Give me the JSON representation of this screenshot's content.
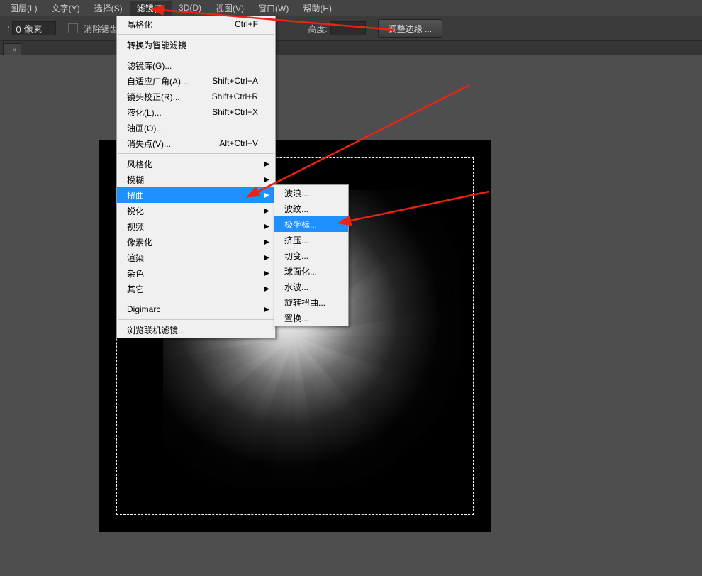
{
  "menubar": {
    "items": [
      "图层(L)",
      "文字(Y)",
      "选择(S)",
      "滤镜(T)",
      "3D(D)",
      "视图(V)",
      "窗口(W)",
      "帮助(H)"
    ],
    "open_index": 3
  },
  "options_bar": {
    "px_value": "0 像素",
    "antialias_label": "消除锯齿",
    "height_label": "高度:",
    "height_value": "",
    "refine_label": "调整边缘 ..."
  },
  "tab": {
    "close_glyph": "×"
  },
  "filter_menu": {
    "items": [
      {
        "label": "晶格化",
        "shortcut": "Ctrl+F"
      },
      "sep",
      {
        "label": "转换为智能滤镜"
      },
      "sep",
      {
        "label": "滤镜库(G)..."
      },
      {
        "label": "自适应广角(A)...",
        "shortcut": "Shift+Ctrl+A"
      },
      {
        "label": "镜头校正(R)...",
        "shortcut": "Shift+Ctrl+R"
      },
      {
        "label": "液化(L)...",
        "shortcut": "Shift+Ctrl+X"
      },
      {
        "label": "油画(O)..."
      },
      {
        "label": "消失点(V)...",
        "shortcut": "Alt+Ctrl+V"
      },
      "sep",
      {
        "label": "风格化",
        "sub": true
      },
      {
        "label": "模糊",
        "sub": true
      },
      {
        "label": "扭曲",
        "sub": true,
        "hl": true
      },
      {
        "label": "锐化",
        "sub": true
      },
      {
        "label": "视频",
        "sub": true
      },
      {
        "label": "像素化",
        "sub": true
      },
      {
        "label": "渲染",
        "sub": true
      },
      {
        "label": "杂色",
        "sub": true
      },
      {
        "label": "其它",
        "sub": true
      },
      "sep",
      {
        "label": "Digimarc",
        "sub": true
      },
      "sep",
      {
        "label": "浏览联机滤镜..."
      }
    ]
  },
  "distort_submenu": {
    "items": [
      {
        "label": "波浪..."
      },
      {
        "label": "波纹..."
      },
      {
        "label": "极坐标...",
        "hl": true
      },
      {
        "label": "挤压..."
      },
      {
        "label": "切变..."
      },
      {
        "label": "球面化..."
      },
      {
        "label": "水波..."
      },
      {
        "label": "旋转扭曲..."
      },
      {
        "label": "置换..."
      }
    ]
  }
}
